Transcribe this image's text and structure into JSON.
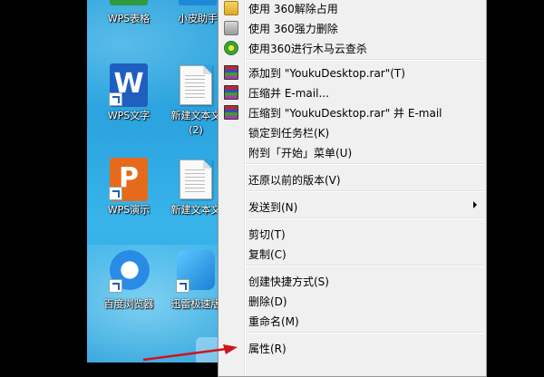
{
  "desktop_icons": [
    {
      "label": "WPS表格",
      "type": "wps-et",
      "color": "#2f9a3e"
    },
    {
      "label": "小皮助手",
      "type": "app",
      "color": "#1f88d8"
    },
    {
      "label": "WPS文字",
      "type": "wps-writer",
      "color": "#1f5fc0",
      "glyph": "W"
    },
    {
      "label": "新建文本文",
      "label2": "(2)",
      "type": "text-doc"
    },
    {
      "label": "WPS演示",
      "type": "wps-presentation",
      "color": "#e66a1b",
      "glyph": "P"
    },
    {
      "label": "新建文本文",
      "type": "text-doc"
    },
    {
      "label": "百度浏览器",
      "type": "baidu-browser",
      "color": "#2a8be6"
    },
    {
      "label": "迅雷极速版",
      "type": "xunlei",
      "color": "#1a98e6"
    }
  ],
  "context_menu": {
    "items": [
      {
        "label": "使用 360解除占用",
        "icon": "360-unlock-icon"
      },
      {
        "label": "使用 360强力删除",
        "icon": "360-shred-icon"
      },
      {
        "label": "使用360进行木马云查杀",
        "icon": "360-scan-icon"
      },
      {
        "label": "添加到 \"YoukuDesktop.rar\"(T)",
        "icon": "winrar-icon"
      },
      {
        "label": "压缩并 E-mail...",
        "icon": "winrar-icon"
      },
      {
        "label": "压缩到 \"YoukuDesktop.rar\" 并 E-mail",
        "icon": "winrar-icon"
      },
      {
        "label": "锁定到任务栏(K)"
      },
      {
        "label": "附到「开始」菜单(U)"
      },
      {
        "label": "还原以前的版本(V)"
      },
      {
        "label": "发送到(N)",
        "submenu": true
      },
      {
        "label": "剪切(T)"
      },
      {
        "label": "复制(C)"
      },
      {
        "label": "创建快捷方式(S)"
      },
      {
        "label": "删除(D)"
      },
      {
        "label": "重命名(M)"
      },
      {
        "label": "属性(R)"
      }
    ]
  },
  "colors": {
    "desktop": "#2ba4e0",
    "menu_bg": "#f0f0f0",
    "annotation_arrow": "#d0141b"
  }
}
